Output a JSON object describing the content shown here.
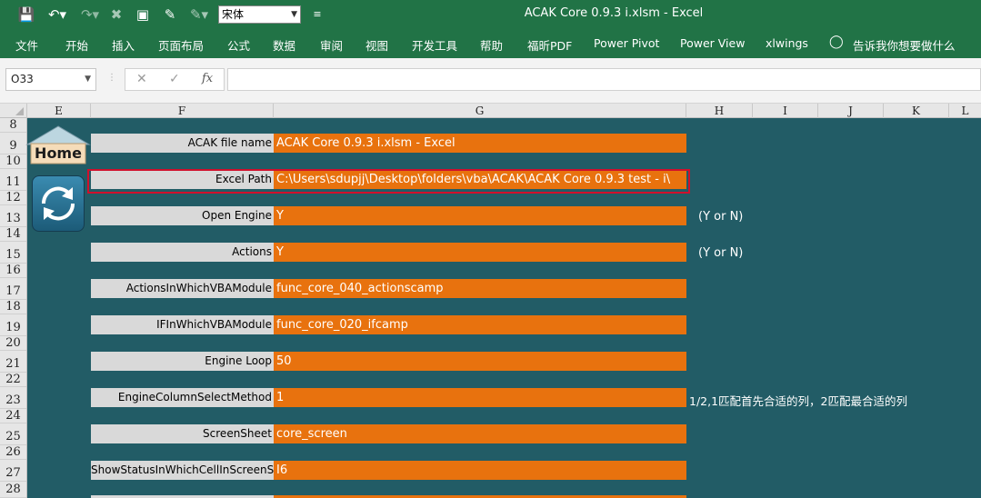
{
  "window": {
    "title": "ACAK Core 0.9.3 i.xlsm  -  Excel"
  },
  "quick_access": {
    "font_name": "宋体"
  },
  "ribbon": {
    "tabs": [
      "文件",
      "开始",
      "插入",
      "页面布局",
      "公式",
      "数据",
      "审阅",
      "视图",
      "开发工具",
      "帮助",
      "福昕PDF",
      "Power Pivot",
      "Power View",
      "xlwings"
    ],
    "tell_me": "告诉我你想要做什么"
  },
  "formula_bar": {
    "name_box": "O33",
    "fx": "fx",
    "value": ""
  },
  "columns": [
    "E",
    "F",
    "G",
    "H",
    "I",
    "J",
    "K",
    "L"
  ],
  "rows": [
    "8",
    "9",
    "10",
    "11",
    "12",
    "13",
    "14",
    "15",
    "16",
    "17",
    "18",
    "19",
    "20",
    "21",
    "22",
    "23",
    "24",
    "25",
    "26",
    "27",
    "28"
  ],
  "buttons": {
    "home": "Home"
  },
  "settings": [
    {
      "label": "ACAK file name",
      "value": "ACAK Core 0.9.3 i.xlsm - Excel",
      "note": ""
    },
    {
      "label": "Excel Path",
      "value": "C:\\Users\\sdupjj\\Desktop\\folders\\vba\\ACAK\\ACAK Core 0.9.3 test - i\\",
      "note": ""
    },
    {
      "label": "Open Engine",
      "value": "Y",
      "note": "(Y or N)"
    },
    {
      "label": "Actions",
      "value": "Y",
      "note": "(Y or N)"
    },
    {
      "label": "ActionsInWhichVBAModule",
      "value": "func_core_040_actionscamp",
      "note": ""
    },
    {
      "label": "IFInWhichVBAModule",
      "value": "func_core_020_ifcamp",
      "note": ""
    },
    {
      "label": "Engine Loop",
      "value": "50",
      "note": ""
    },
    {
      "label": "EngineColumnSelectMethod",
      "value": "1",
      "note": "1/2,1匹配首先合适的列，2匹配最合适的列"
    },
    {
      "label": "ScreenSheet",
      "value": "core_screen",
      "note": ""
    },
    {
      "label": "ShowStatusInWhichCellInScreenSheet",
      "value": "I6",
      "note": ""
    }
  ]
}
